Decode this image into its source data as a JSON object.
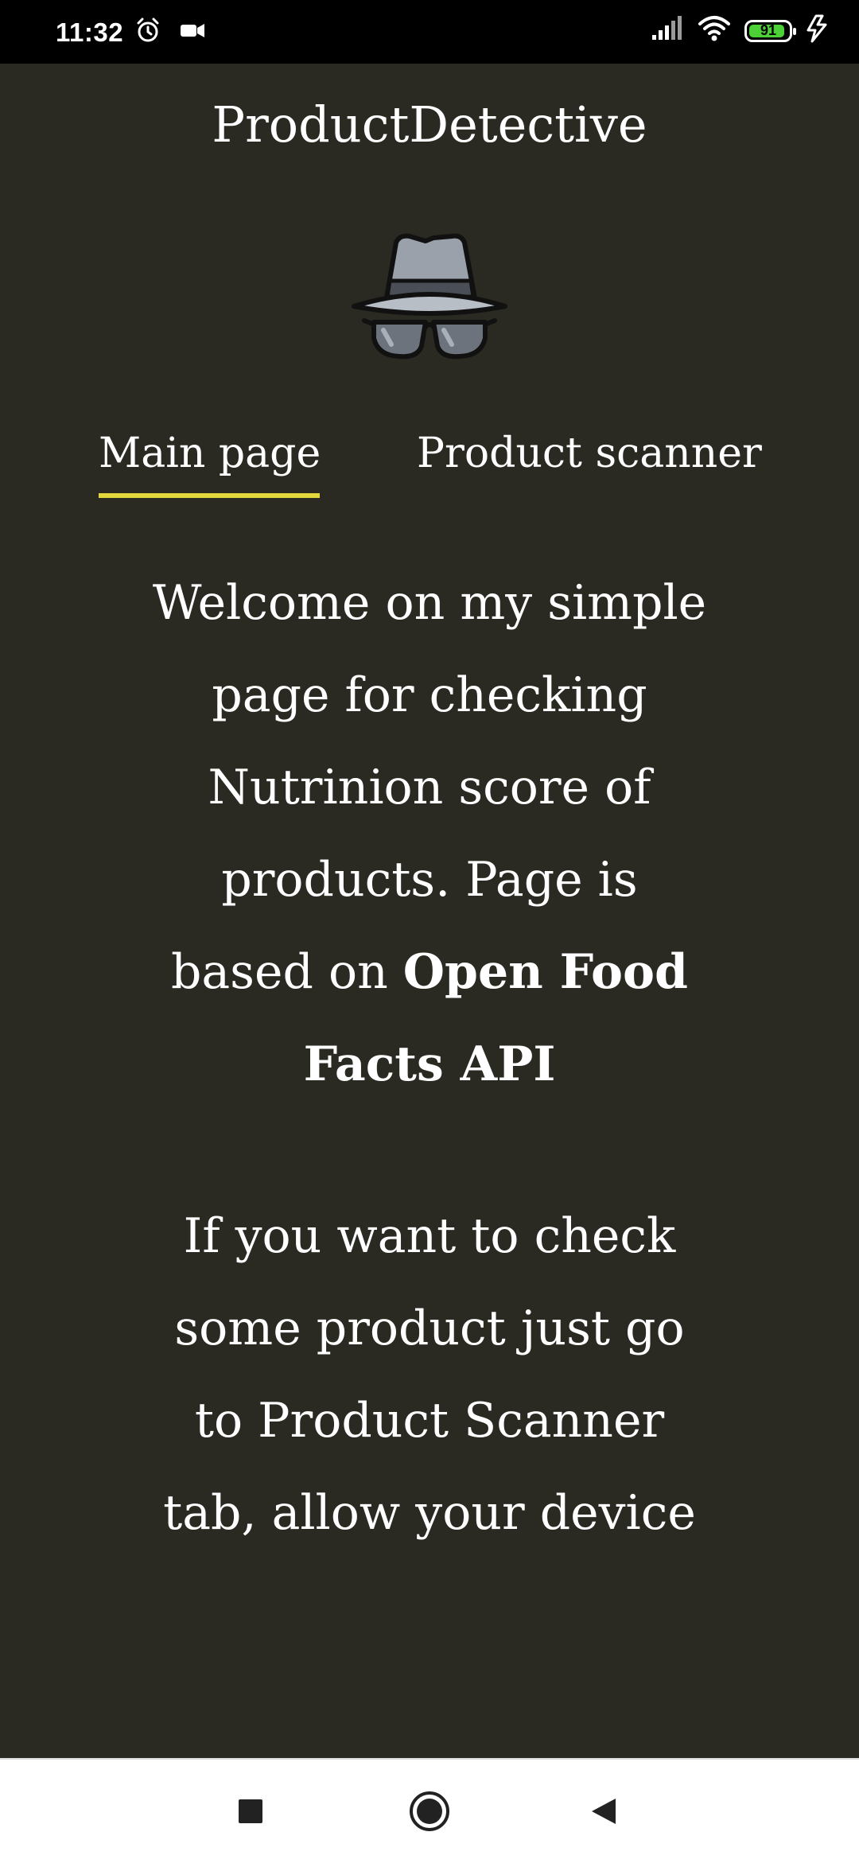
{
  "status_bar": {
    "time": "11:32",
    "battery_level": "91",
    "battery_fraction": 0.91,
    "icons": [
      "alarm-icon",
      "video-camera-icon",
      "signal-icon",
      "wifi-icon",
      "battery-icon",
      "charging-icon"
    ],
    "battery_color": "#4cd137"
  },
  "header": {
    "title": "ProductDetective",
    "logo_icon": "detective-hat-glasses-icon"
  },
  "tabs": [
    {
      "label": "Main page",
      "active": true
    },
    {
      "label": "Product scanner",
      "active": false
    }
  ],
  "accent_color": "#e2d83d",
  "background_color": "#2a2a22",
  "content": {
    "intro_plain": "Welcome on my simple page for checking Nutrinion score of products. Page is based on ",
    "intro_bold": "Open Food Facts API",
    "instructions": "If you want to check some product just go to Product Scanner tab, allow your device"
  },
  "nav_bar": {
    "icons": [
      "recent-apps-square-icon",
      "home-circle-icon",
      "back-triangle-icon"
    ]
  }
}
